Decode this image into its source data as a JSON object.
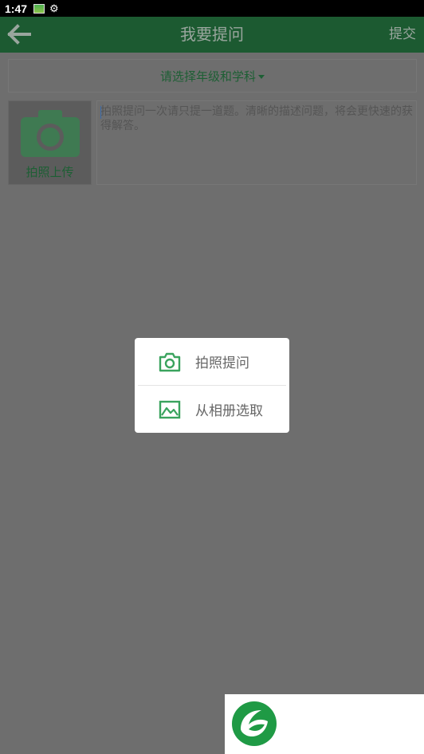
{
  "status_bar": {
    "time": "1:47",
    "icons": [
      "image-notification-icon",
      "settings-gear-icon"
    ]
  },
  "app_bar": {
    "title": "我要提问",
    "submit_label": "提交",
    "back_icon": "back-arrow-icon"
  },
  "grade_subject_selector": {
    "label": "请选择年级和学科"
  },
  "photo_upload": {
    "label": "拍照上传",
    "icon": "camera-icon"
  },
  "question_input": {
    "placeholder": "拍照提问一次请只提一道题。清晰的描述问题，将会更快速的获得解答。"
  },
  "photo_popup": {
    "items": [
      {
        "label": "拍照提问",
        "icon": "camera-icon"
      },
      {
        "label": "从相册选取",
        "icon": "gallery-icon"
      }
    ]
  },
  "colors": {
    "brand_green": "#1c5a31",
    "accent_green": "#3aa35e",
    "overlay_gray": "#6e6e6e"
  }
}
